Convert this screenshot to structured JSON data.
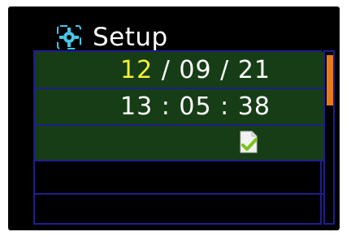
{
  "header": {
    "title": "Setup",
    "icon": "setup-gear-icon",
    "icon_color": "#47c7e6"
  },
  "date": {
    "day": "12",
    "sep1": " / ",
    "month": "09",
    "sep2": " / ",
    "year": "21"
  },
  "time": {
    "hour": "13",
    "sep1": " : ",
    "minute": "05",
    "sep2": " : ",
    "second": "38"
  },
  "confirm": {
    "icon": "confirm-check-icon"
  },
  "colors": {
    "selected_row": "#173d17",
    "frame": "#1e1e8c",
    "active_field": "#f4f03a",
    "scroll_thumb": "#e87a1e"
  }
}
